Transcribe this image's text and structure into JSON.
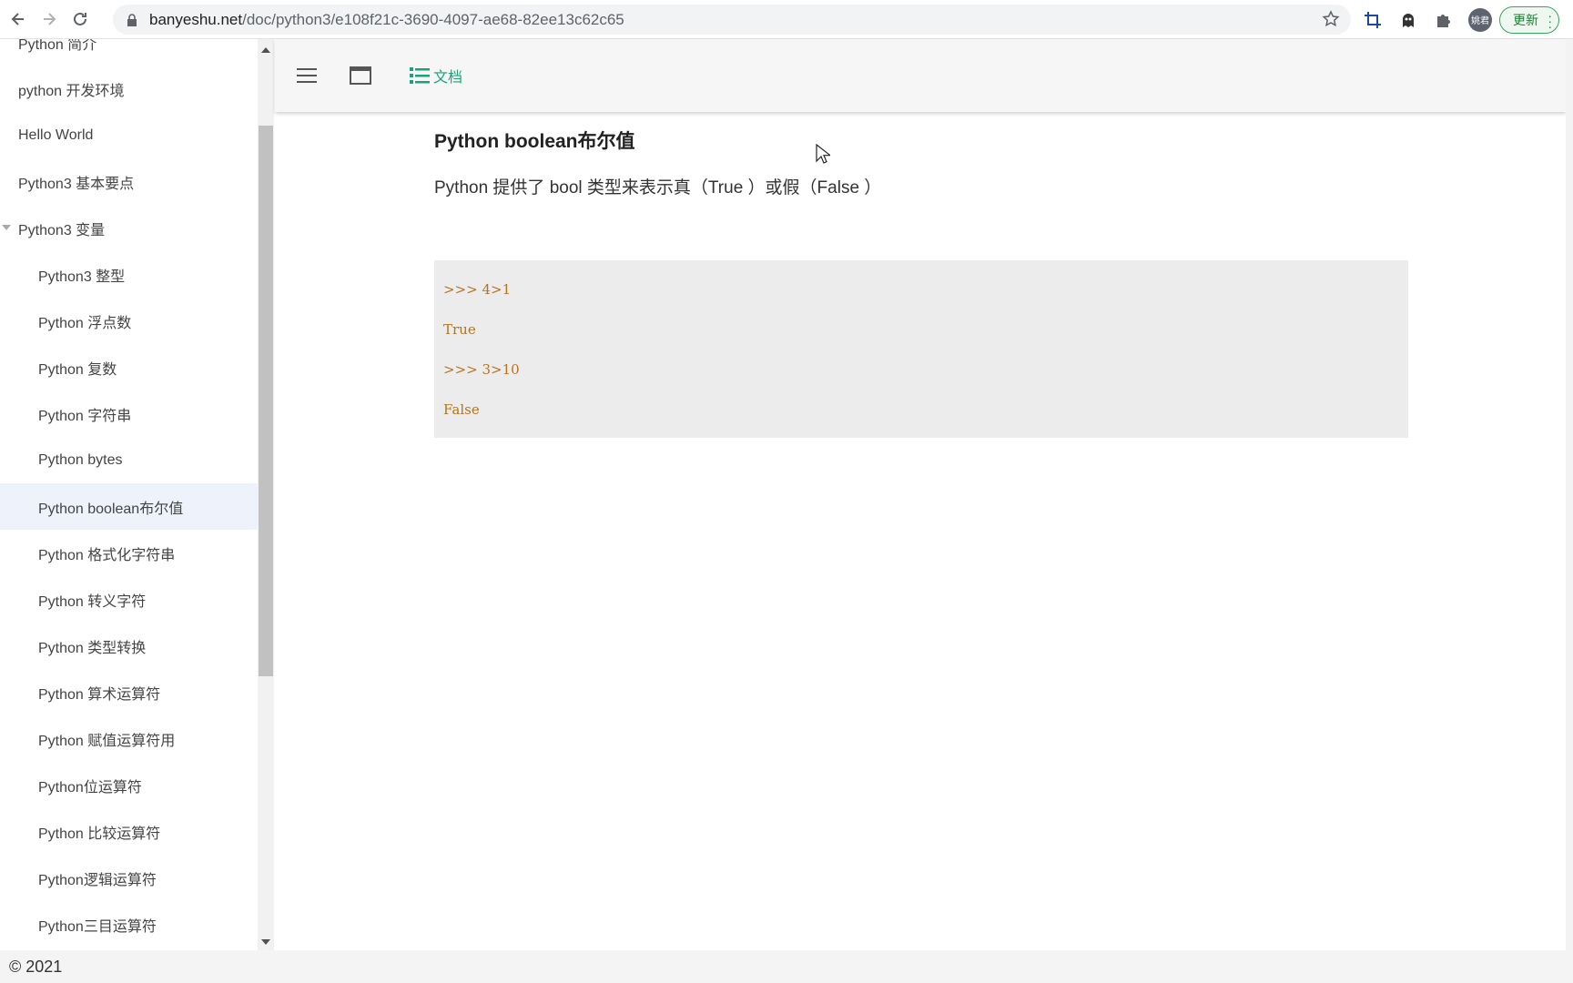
{
  "browser": {
    "url_host": "banyeshu.net",
    "url_path": "/doc/python3/e108f21c-3690-4097-ae68-82ee13c62c65",
    "avatar_text": "姚君",
    "update_label": "更新"
  },
  "sidebar": {
    "items": [
      {
        "label": "Python 简介"
      },
      {
        "label": "python 开发环境"
      },
      {
        "label": "Hello World"
      },
      {
        "label": "Python3 基本要点"
      },
      {
        "label": "Python3 变量"
      },
      {
        "label": "Python3 整型"
      },
      {
        "label": "Python 浮点数"
      },
      {
        "label": "Python 复数"
      },
      {
        "label": "Python 字符串"
      },
      {
        "label": "Python bytes"
      },
      {
        "label": "Python boolean布尔值"
      },
      {
        "label": "Python 格式化字符串"
      },
      {
        "label": "Python 转义字符"
      },
      {
        "label": "Python 类型转换"
      },
      {
        "label": "Python 算术运算符"
      },
      {
        "label": "Python 赋值运算符用"
      },
      {
        "label": "Python位运算符"
      },
      {
        "label": "Python 比较运算符"
      },
      {
        "label": "Python逻辑运算符"
      },
      {
        "label": "Python三目运算符"
      }
    ]
  },
  "toolbar": {
    "docs_label": "文档"
  },
  "doc": {
    "title": "Python boolean布尔值",
    "paragraph": "Python 提供了 bool 类型来表示真（True ）或假（False ）",
    "code_lines": [
      ">>> 4>1",
      "True",
      ">>> 3>10",
      "False"
    ]
  },
  "footer": {
    "copyright": "© 2021"
  },
  "colors": {
    "accent": "#1aa37a",
    "code_text": "#b8731b",
    "code_bg": "#ececec",
    "active_item_bg": "#eef2fa"
  }
}
